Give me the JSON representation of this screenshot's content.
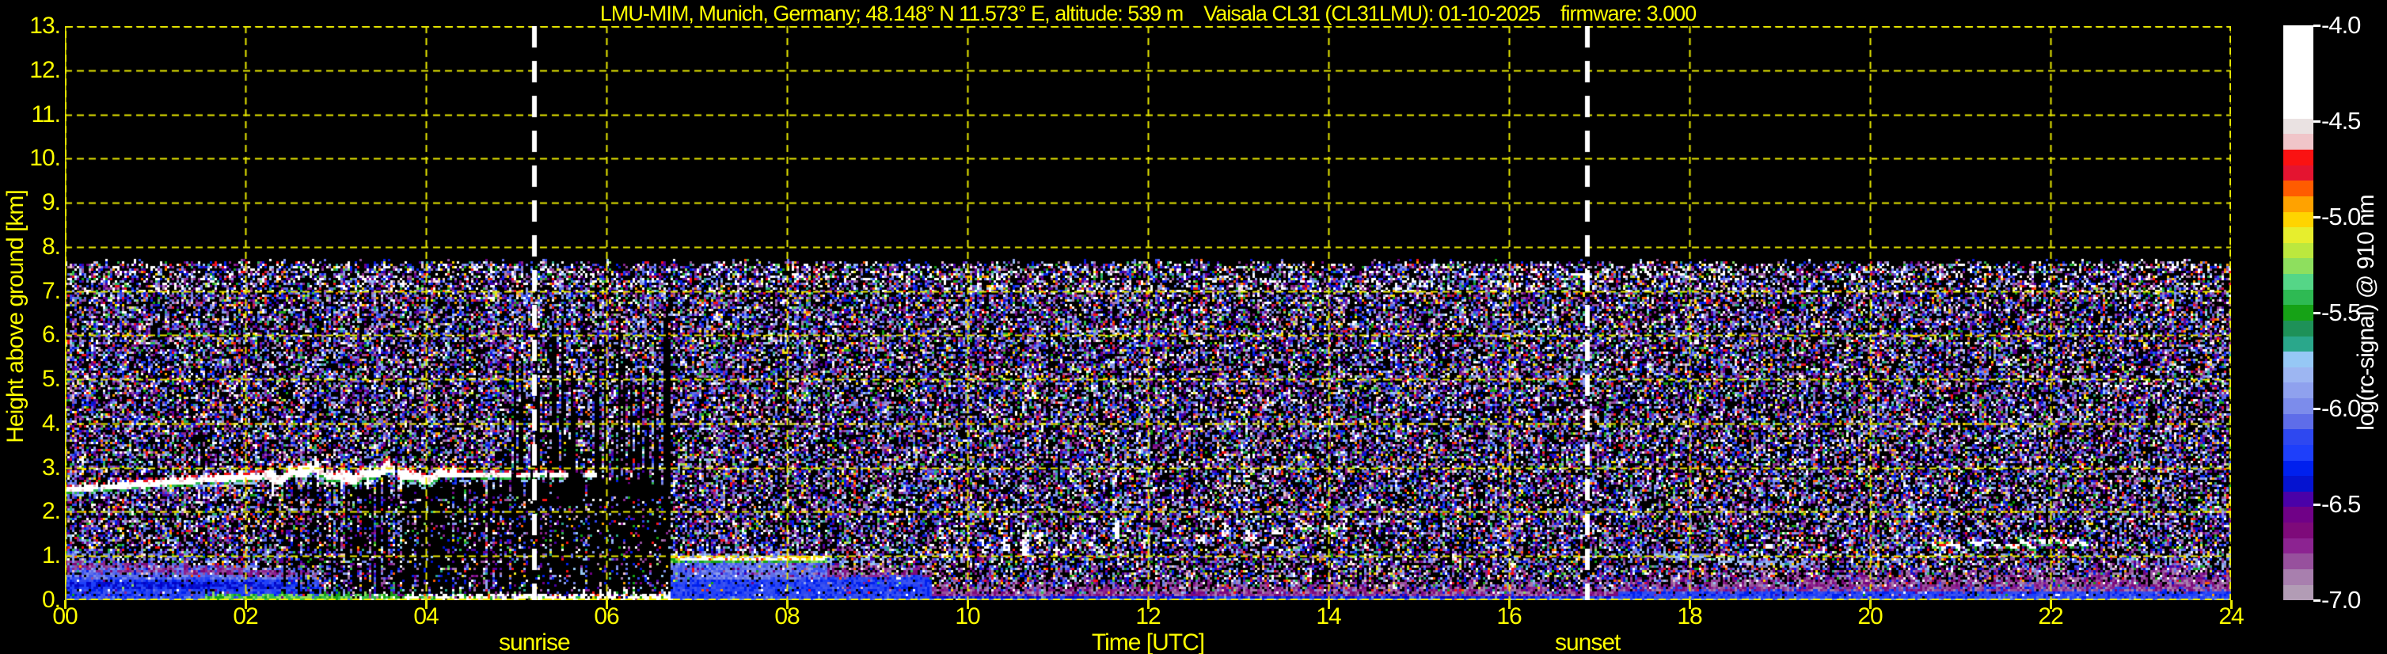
{
  "title": "LMU-MIM, Munich, Germany; 48.148° N 11.573° E, altitude: 539 m    Vaisala CL31 (CL31LMU): 01-10-2025    firmware: 3.000",
  "plot": {
    "xlabel": "Time [UTC]",
    "ylabel": "Height above ground [km]",
    "x_tick_labels": [
      "00",
      "02",
      "04",
      "06",
      "08",
      "10",
      "12",
      "14",
      "16",
      "18",
      "20",
      "22",
      "24"
    ],
    "x_tick_values": [
      0,
      2,
      4,
      6,
      8,
      10,
      12,
      14,
      16,
      18,
      20,
      22,
      24
    ],
    "y_tick_labels": [
      "0.",
      "1.",
      "2.",
      "3.",
      "4.",
      "5.",
      "6.",
      "7.",
      "8.",
      "9.",
      "10.",
      "11.",
      "12.",
      "13."
    ],
    "y_tick_values": [
      0,
      1,
      2,
      3,
      4,
      5,
      6,
      7,
      8,
      9,
      10,
      11,
      12,
      13
    ],
    "grid_color": "#e8e800",
    "text_color": "#ffff00",
    "background_color": "#000000"
  },
  "colorbar": {
    "label": "log(rc-signal) @ 910 nm",
    "tick_labels": [
      "-4.0",
      "-4.5",
      "-5.0",
      "-5.5",
      "-6.0",
      "-6.5",
      "-7.0"
    ],
    "tick_values": [
      -4.0,
      -4.5,
      -5.0,
      -5.5,
      -6.0,
      -6.5,
      -7.0
    ],
    "colors_top_to_bottom": [
      "#ffffff",
      "#ffffff",
      "#ffffff",
      "#ffffff",
      "#ffffff",
      "#ffffff",
      "#eae2e2",
      "#f0c5c9",
      "#fa1212",
      "#e41430",
      "#ff5c00",
      "#ffa200",
      "#ffd400",
      "#e7ee2d",
      "#bce83e",
      "#8edf5e",
      "#55d687",
      "#2eba53",
      "#16a216",
      "#1e9158",
      "#2aa78b",
      "#96c8f5",
      "#9db6f2",
      "#8fa1ee",
      "#7c8ceb",
      "#5e6de9",
      "#2e48f0",
      "#1e3ffa",
      "#0020ee",
      "#0513d0",
      "#4a01a8",
      "#700187",
      "#7e0a7a",
      "#8c2391",
      "#97509d",
      "#a87fae",
      "#b29cb5"
    ]
  },
  "annotations": {
    "sunrise_label": "sunrise",
    "sunrise_time_utc": 5.2,
    "sunset_label": "sunset",
    "sunset_time_utc": 16.87,
    "line_color": "#ffffff",
    "line_style": "dashed"
  },
  "chart_data": {
    "type": "heatmap",
    "title": "LMU-MIM, Munich, Germany; 48.148° N 11.573° E, altitude: 539 m    Vaisala CL31 (CL31LMU): 01-10-2025    firmware: 3.000",
    "xlabel": "Time [UTC]",
    "ylabel": "Height above ground [km]",
    "x_range_hours": [
      0,
      24
    ],
    "y_range_km": [
      0,
      13
    ],
    "colorbar_label": "log(rc-signal) @ 910 nm",
    "colorbar_range": [
      -4.0,
      -7.0
    ],
    "instrument_max_range_km": 7.62,
    "sunrise_utc": 5.2,
    "sunset_utc": 16.87,
    "features": {
      "noise_region": {
        "t": [
          0,
          24
        ],
        "h_km": [
          0,
          7.62
        ],
        "desc": "speckled blue/purple background noise, whiter band near 7.0-7.6 km"
      },
      "stratus_layer": {
        "t": [
          0,
          6.35
        ],
        "base_km_start": 2.45,
        "base_km_end": 2.8,
        "desc": "bright white layer, wavy 02:10-04:20, broken after 04:50"
      },
      "attenuated_zone": {
        "t": [
          2.25,
          6.72
        ],
        "below_km": 3.0,
        "desc": "black vertical streaks below cloud, tall black columns 04:50-06:40"
      },
      "surface_green_layer": {
        "t": [
          1.55,
          6.75
        ],
        "top_km": 0.12,
        "desc": "green surface layer turning white/saturated after 03:30"
      },
      "morning_capping_layer": {
        "t": [
          6.7,
          8.45
        ],
        "height_km": 0.97,
        "desc": "white/yellow stable-layer top with green fringe over blue layer"
      },
      "mixed_layer_haze": {
        "t": [
          9.6,
          24
        ],
        "top_km_range": [
          0.45,
          0.86
        ],
        "desc": "mauve/purple plume band over blue surface layer"
      },
      "evening_layer_descending": {
        "t": [
          17.35,
          19.5
        ],
        "from_km": 1.08,
        "to_km": 0.8,
        "desc": "light-blue speckle layer descending"
      },
      "cumulus_puffs": [
        [
          9.35,
          0.88,
          0.05,
          0.07
        ],
        [
          9.5,
          0.95,
          0.05,
          0.08
        ],
        [
          9.72,
          1.0,
          0.05,
          0.1
        ],
        [
          9.95,
          1.07,
          0.04,
          0.13
        ],
        [
          10.17,
          1.12,
          0.05,
          0.2
        ],
        [
          10.42,
          1.2,
          0.04,
          0.26
        ],
        [
          10.63,
          1.12,
          0.03,
          0.5
        ],
        [
          10.78,
          1.3,
          0.05,
          0.3
        ],
        [
          10.97,
          1.05,
          0.04,
          0.16
        ],
        [
          11.17,
          1.45,
          0.04,
          0.32
        ],
        [
          11.35,
          1.2,
          0.03,
          0.12
        ],
        [
          11.47,
          1.12,
          0.05,
          0.22
        ],
        [
          11.63,
          1.5,
          0.04,
          0.36
        ],
        [
          11.95,
          1.22,
          0.03,
          0.2
        ],
        [
          12.2,
          1.3,
          0.04,
          0.1
        ],
        [
          12.55,
          1.35,
          0.06,
          0.16
        ],
        [
          12.82,
          1.5,
          0.05,
          0.3
        ],
        [
          13.1,
          1.38,
          0.08,
          0.22
        ],
        [
          13.38,
          1.55,
          0.1,
          0.12
        ],
        [
          13.62,
          1.62,
          0.2,
          0.1
        ],
        [
          13.95,
          1.6,
          0.25,
          0.08
        ],
        [
          18.85,
          1.22,
          0.05,
          0.1
        ],
        [
          19.05,
          1.32,
          0.03,
          0.06
        ],
        [
          20.7,
          1.2,
          0.28,
          0.09
        ],
        [
          21.1,
          1.28,
          0.3,
          0.11
        ],
        [
          21.5,
          1.23,
          0.32,
          0.12
        ],
        [
          21.88,
          1.32,
          0.28,
          0.1
        ],
        [
          22.18,
          1.28,
          0.22,
          0.08
        ]
      ],
      "virga_streaks_utc": [
        10.62,
        11.62,
        13.08
      ]
    }
  }
}
